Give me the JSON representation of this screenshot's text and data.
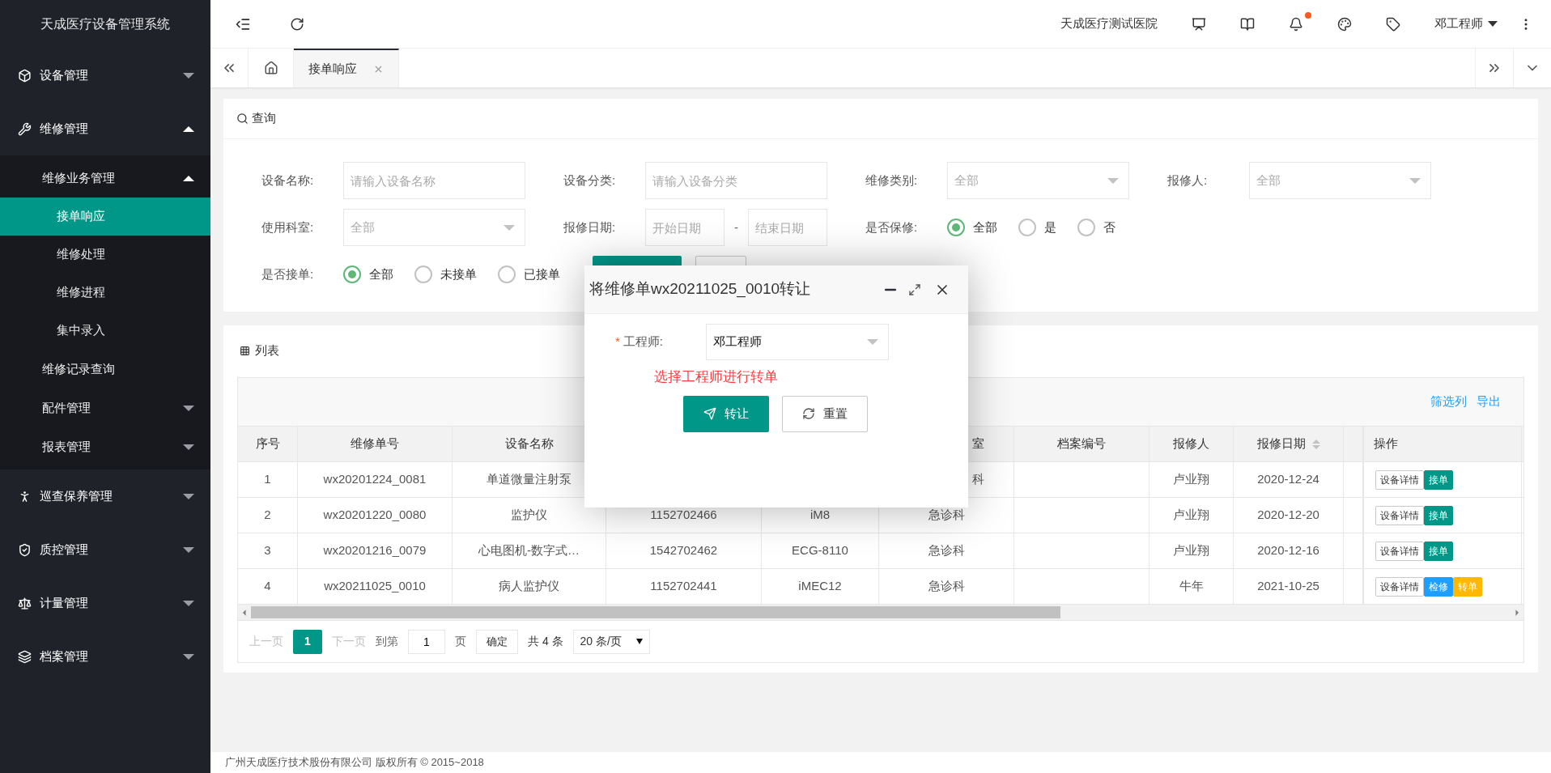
{
  "sidebar": {
    "title": "天成医疗设备管理系统",
    "items": [
      {
        "label": "设备管理",
        "expanded": false
      },
      {
        "label": "维修管理",
        "expanded": true,
        "children": [
          {
            "label": "维修业务管理",
            "expanded": true,
            "children": [
              {
                "label": "接单响应",
                "selected": true
              },
              {
                "label": "维修处理",
                "selected": false
              },
              {
                "label": "维修进程",
                "selected": false
              },
              {
                "label": "集中录入",
                "selected": false
              }
            ]
          },
          {
            "label": "维修记录查询"
          },
          {
            "label": "配件管理",
            "expanded": false
          },
          {
            "label": "报表管理",
            "expanded": false
          }
        ]
      },
      {
        "label": "巡查保养管理",
        "expanded": false
      },
      {
        "label": "质控管理",
        "expanded": false
      },
      {
        "label": "计量管理",
        "expanded": false
      },
      {
        "label": "档案管理",
        "expanded": false
      }
    ]
  },
  "header": {
    "hospital": "天成医疗测试医院",
    "notification_dot": true,
    "user": "邓工程师"
  },
  "tabs": [
    {
      "label": "接单响应",
      "selected": true
    }
  ],
  "query": {
    "title": "查询",
    "rows": [
      [
        {
          "kind": "text",
          "label": "设备名称:",
          "placeholder": "请输入设备名称"
        },
        {
          "kind": "text",
          "label": "设备分类:",
          "placeholder": "请输入设备分类"
        },
        {
          "kind": "select",
          "label": "维修类别:",
          "placeholder": "全部"
        },
        {
          "kind": "select",
          "label": "报修人:",
          "placeholder": "全部"
        }
      ],
      [
        {
          "kind": "select",
          "label": "使用科室:",
          "placeholder": "全部"
        },
        {
          "kind": "daterange",
          "label": "报修日期:",
          "start_placeholder": "开始日期",
          "separator": "-",
          "end_placeholder": "结束日期"
        },
        {
          "kind": "radio",
          "label": "是否保修:",
          "options": [
            {
              "label": "全部",
              "selected": true
            },
            {
              "label": "是",
              "selected": false
            },
            {
              "label": "否",
              "selected": false
            }
          ]
        }
      ],
      [
        {
          "kind": "radio",
          "label": "是否接单:",
          "options": [
            {
              "label": "全部",
              "selected": true
            },
            {
              "label": "未接单",
              "selected": false
            },
            {
              "label": "已接单",
              "selected": false
            }
          ]
        }
      ]
    ]
  },
  "list": {
    "title": "列表",
    "toolbar": [
      "筛选列",
      "导出"
    ],
    "header": {
      "no": "序号",
      "order_no": "维修单号",
      "device_name": "设备名称",
      "column_6": "室",
      "archive_no": "档案编号",
      "reporter": "报修人",
      "date": "报修日期",
      "actions": "操作"
    },
    "rows": [
      {
        "no": "1",
        "order_no": "wx20201224_0081",
        "device_name": "单道微量注射泵",
        "column_6": "科",
        "reporter": "卢业翔",
        "date": "2020-12-24",
        "actions": [
          {
            "label": "设备详情",
            "kind": "outline"
          },
          {
            "label": "接单",
            "kind": "primary"
          }
        ]
      },
      {
        "no": "2",
        "order_no": "wx20201220_0080",
        "device_name": "监护仪",
        "column_4": "1152702466",
        "column_5": "iM8",
        "column_6": "急诊科",
        "reporter": "卢业翔",
        "date": "2020-12-20",
        "actions": [
          {
            "label": "设备详情",
            "kind": "outline"
          },
          {
            "label": "接单",
            "kind": "primary"
          }
        ]
      },
      {
        "no": "3",
        "order_no": "wx20201216_0079",
        "device_name": "心电图机-数字式…",
        "column_4": "1542702462",
        "column_5": "ECG-8110",
        "column_6": "急诊科",
        "reporter": "卢业翔",
        "date": "2020-12-16",
        "actions": [
          {
            "label": "设备详情",
            "kind": "outline"
          },
          {
            "label": "接单",
            "kind": "primary"
          }
        ]
      },
      {
        "no": "4",
        "order_no": "wx20211025_0010",
        "device_name": "病人监护仪",
        "column_4": "1152702441",
        "column_5": "iMEC12",
        "column_6": "急诊科",
        "reporter": "牛年",
        "date": "2021-10-25",
        "actions": [
          {
            "label": "设备详情",
            "kind": "outline"
          },
          {
            "label": "检修",
            "kind": "info"
          },
          {
            "label": "转单",
            "kind": "warning"
          }
        ]
      }
    ],
    "pagination": {
      "prev": "上一页",
      "pages": [
        {
          "label": "1",
          "selected": true
        }
      ],
      "next": "下一页",
      "goto_label": "到第",
      "goto_value": "1",
      "page_unit": "页",
      "confirm": "确定",
      "total": "共 4 条",
      "page_size": "20 条/页"
    }
  },
  "dialog": {
    "title": "将维修单wx20211025_0010转让",
    "field_label": "工程师:",
    "required_mark": "*",
    "value": "邓工程师",
    "hint": "选择工程师进行转单",
    "buttons": [
      {
        "label": "转让",
        "kind": "primary"
      },
      {
        "label": "重置",
        "kind": "outline"
      }
    ]
  },
  "footer": "广州天成医疗技术股份有限公司 版权所有 © 2015~2018"
}
